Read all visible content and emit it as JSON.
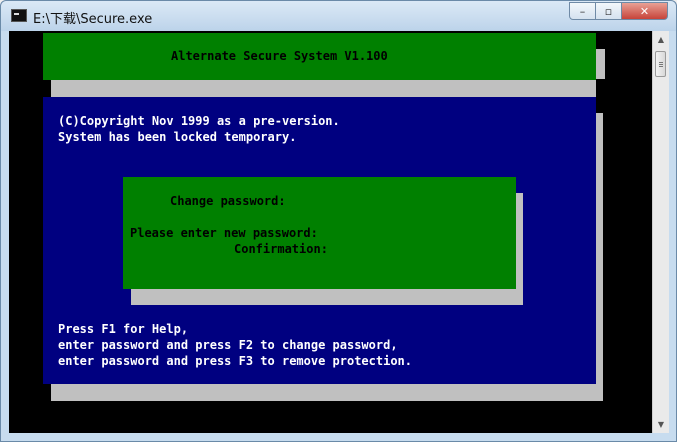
{
  "window": {
    "title": "E:\\下载\\Secure.exe",
    "buttons": {
      "minimize": "–",
      "maximize": "▫",
      "close": "✕"
    }
  },
  "console": {
    "banner": "Alternate Secure System V1.100",
    "notice_lines": [
      "(C)Copyright Nov 1999 as a pre-version.",
      "System has been locked temporary."
    ],
    "dialog": {
      "heading": "Change password:",
      "new_password_label": "Please enter new password:",
      "confirmation_label": "Confirmation:"
    },
    "help_lines": [
      "Press F1 for Help,",
      "enter password and press F2 to change password,",
      "enter password and press F3 to remove protection."
    ]
  },
  "colors": {
    "banner_green": "#008000",
    "panel_blue": "#000080",
    "shadow_gray": "#c0c0c0",
    "console_black": "#000000"
  },
  "icons": {
    "app": "console-app-icon",
    "scroll_up": "arrow-up-icon",
    "scroll_down": "arrow-down-icon"
  }
}
